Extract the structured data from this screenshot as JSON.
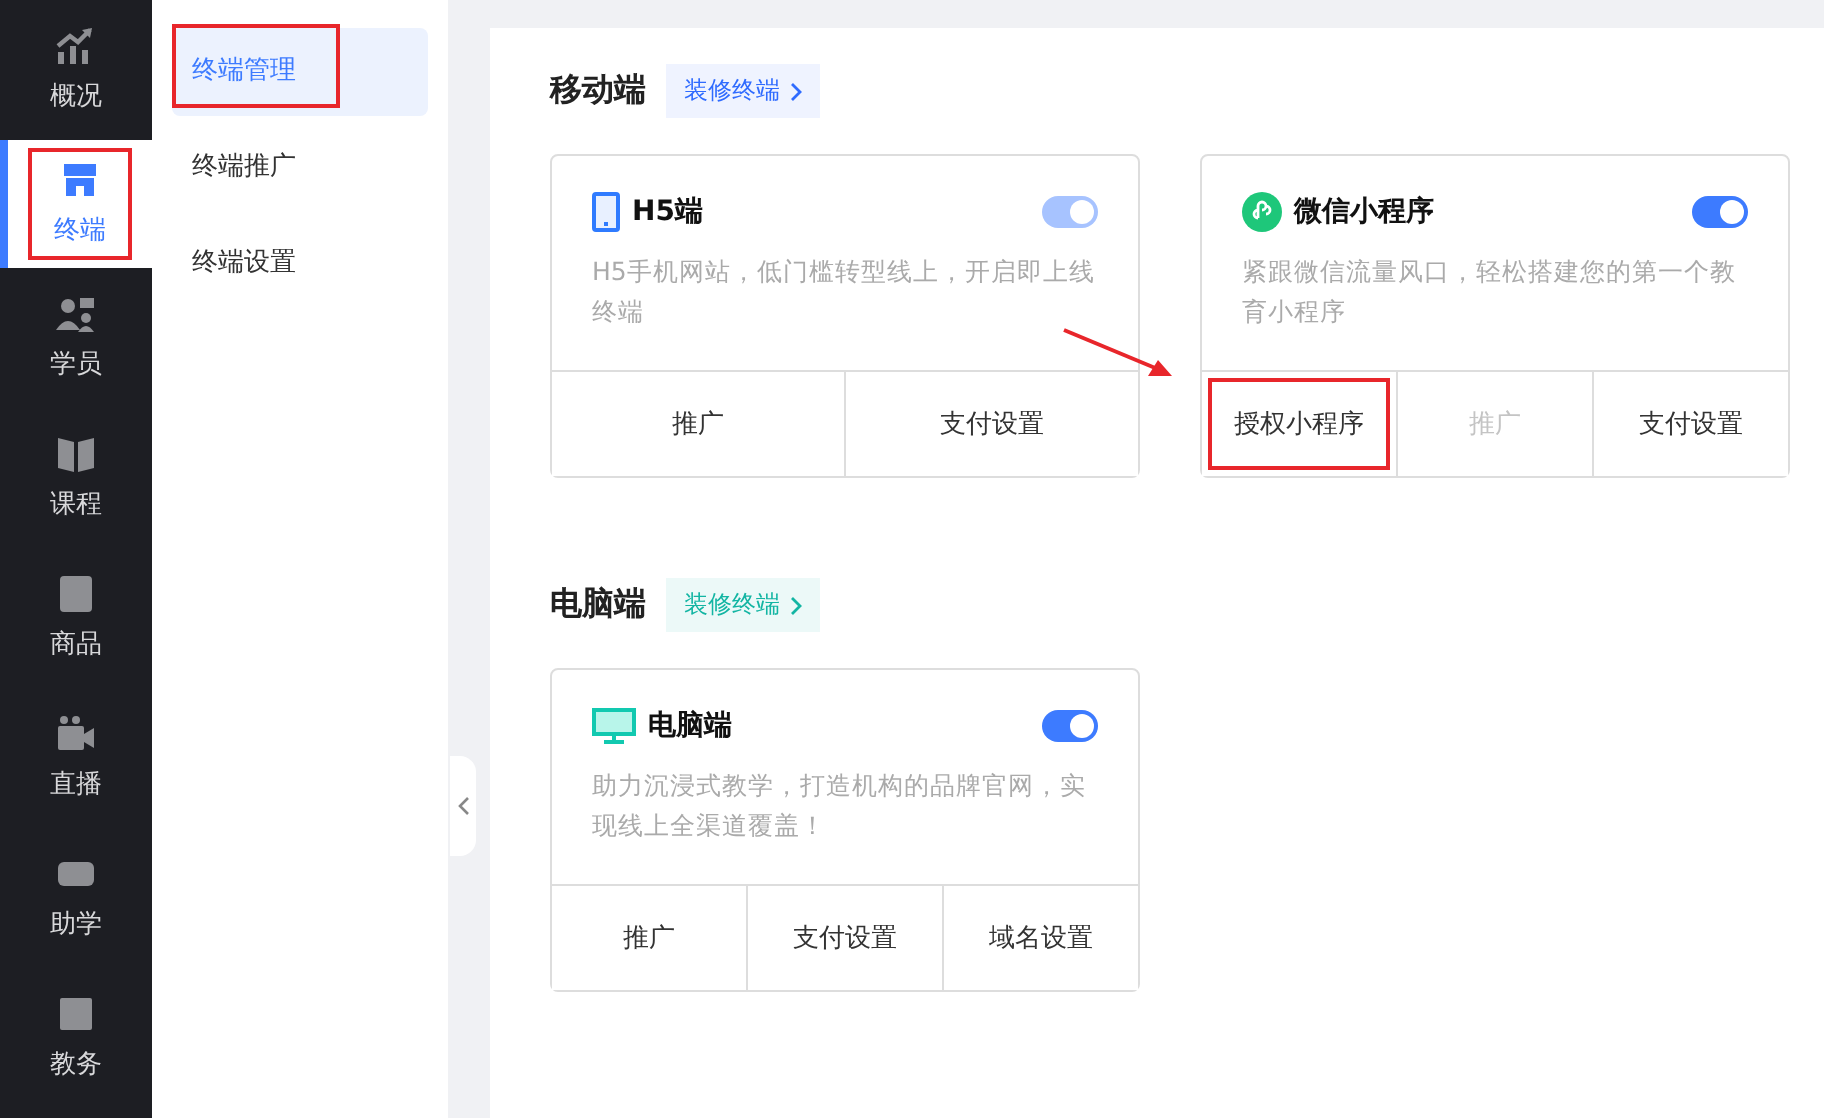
{
  "nav": [
    {
      "label": "概况",
      "kind": "chart",
      "selected": false,
      "annotated": false
    },
    {
      "label": "终端",
      "kind": "store",
      "selected": true,
      "annotated": true
    },
    {
      "label": "学员",
      "kind": "people",
      "selected": false,
      "annotated": false
    },
    {
      "label": "课程",
      "kind": "book",
      "selected": false,
      "annotated": false
    },
    {
      "label": "商品",
      "kind": "bag",
      "selected": false,
      "annotated": false
    },
    {
      "label": "直播",
      "kind": "camera",
      "selected": false,
      "annotated": false
    },
    {
      "label": "助学",
      "kind": "gamepad",
      "selected": false,
      "annotated": false
    },
    {
      "label": "教务",
      "kind": "box",
      "selected": false,
      "annotated": false
    }
  ],
  "submenu": [
    {
      "label": "终端管理",
      "selected": true,
      "annotated": true
    },
    {
      "label": "终端推广",
      "selected": false,
      "annotated": false
    },
    {
      "label": "终端设置",
      "selected": false,
      "annotated": false
    }
  ],
  "sections": [
    {
      "title": "移动端",
      "link": "装修终端",
      "color": "#2f6bff",
      "cards": [
        {
          "kind": "phone",
          "title": "H5端",
          "on": true,
          "disabled": true,
          "description": "H5手机网站，低门槛转型线上，开启即上线终端",
          "actions": [
            {
              "label": "推广",
              "disabled": false,
              "annotated": false
            },
            {
              "label": "支付设置",
              "disabled": false,
              "annotated": false
            }
          ]
        },
        {
          "kind": "miniprogram",
          "title": "微信小程序",
          "on": true,
          "disabled": false,
          "description": "紧跟微信流量风口，轻松搭建您的第一个教育小程序",
          "actions": [
            {
              "label": "授权小程序",
              "disabled": false,
              "annotated": true
            },
            {
              "label": "推广",
              "disabled": true,
              "annotated": false
            },
            {
              "label": "支付设置",
              "disabled": false,
              "annotated": false
            }
          ]
        }
      ]
    },
    {
      "title": "电脑端",
      "link": "装修终端",
      "color": "#13b5a3",
      "cards": [
        {
          "kind": "monitor",
          "title": "电脑端",
          "on": true,
          "disabled": false,
          "description": "助力沉浸式教学，打造机构的品牌官网，实现线上全渠道覆盖！",
          "actions": [
            {
              "label": "推广",
              "disabled": false,
              "annotated": false
            },
            {
              "label": "支付设置",
              "disabled": false,
              "annotated": false
            },
            {
              "label": "域名设置",
              "disabled": false,
              "annotated": false
            }
          ]
        }
      ]
    }
  ]
}
